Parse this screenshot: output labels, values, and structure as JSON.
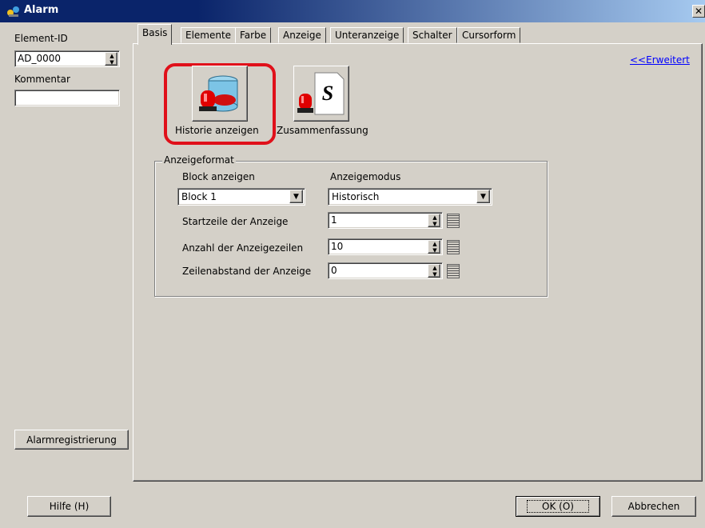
{
  "window": {
    "title": "Alarm",
    "close_label": "✕"
  },
  "left": {
    "element_id_label": "Element-ID",
    "element_id_value": "AD_0000",
    "comment_label": "Kommentar",
    "comment_value": "",
    "alarm_registration_button": "Alarmregistrierung"
  },
  "tabs": [
    {
      "label": "Basis",
      "active": true
    },
    {
      "label": "Elemente"
    },
    {
      "label": "Farbe"
    },
    {
      "label": "Anzeige"
    },
    {
      "label": "Unteranzeige"
    },
    {
      "label": "Schalter"
    },
    {
      "label": "Cursorform"
    }
  ],
  "advanced_link": "<<Erweitert",
  "mode_icons": [
    {
      "label": "Historie anzeigen",
      "selected": true,
      "icon": "alarm-history-icon"
    },
    {
      "label": "Zusammenfassung",
      "selected": false,
      "icon": "alarm-summary-icon"
    }
  ],
  "display_format": {
    "group_label": "Anzeigeformat",
    "block_label": "Block anzeigen",
    "block_value": "Block 1",
    "mode_label": "Anzeigemodus",
    "mode_value": "Historisch",
    "start_row_label": "Startzeile der Anzeige",
    "start_row_value": "1",
    "rows_label": "Anzahl der Anzeigezeilen",
    "rows_value": "10",
    "spacing_label": "Zeilenabstand der Anzeige",
    "spacing_value": "0"
  },
  "footer": {
    "help_label": "Hilfe (H)",
    "ok_label": "OK (O)",
    "cancel_label": "Abbrechen"
  },
  "colors": {
    "titlebar_start": "#0a246a",
    "titlebar_end": "#a6caf0",
    "selection_highlight": "#e0101a",
    "link": "#0000ff",
    "face": "#d4d0c8"
  }
}
